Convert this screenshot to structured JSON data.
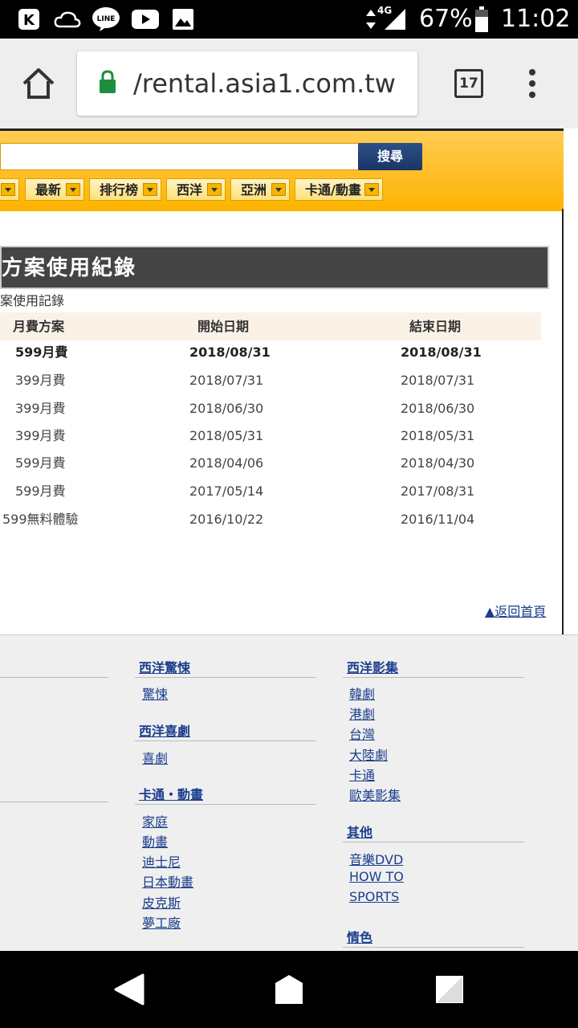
{
  "status_bar": {
    "battery_percent": "67%",
    "time": "11:02",
    "network": "4G",
    "icons": [
      "k-app-icon",
      "cloud-icon",
      "line-icon",
      "youtube-icon",
      "gallery-icon",
      "data-arrows-icon",
      "signal-icon",
      "battery-icon"
    ]
  },
  "browser": {
    "url": "/rental.asia1.com.tw",
    "tab_count": "17",
    "icons": [
      "home-icon",
      "lock-icon",
      "tabs-icon",
      "more-vert-icon"
    ]
  },
  "header": {
    "search_button": "搜尋",
    "search_value": "",
    "nav_tabs": [
      "最新",
      "排行榜",
      "西洋",
      "亞洲",
      "卡通/動畫"
    ]
  },
  "section": {
    "title": "方案使用紀錄",
    "caption": "案使用記錄"
  },
  "table": {
    "columns": [
      "月費方案",
      "開始日期",
      "結束日期"
    ],
    "rows": [
      {
        "plan": "599月費",
        "start": "2018/08/31",
        "end": "2018/08/31",
        "bold": true
      },
      {
        "plan": "399月費",
        "start": "2018/07/31",
        "end": "2018/07/31"
      },
      {
        "plan": "399月費",
        "start": "2018/06/30",
        "end": "2018/06/30"
      },
      {
        "plan": "399月費",
        "start": "2018/05/31",
        "end": "2018/05/31"
      },
      {
        "plan": "599月費",
        "start": "2018/04/06",
        "end": "2018/04/30"
      },
      {
        "plan": "599月費",
        "start": "2017/05/14",
        "end": "2017/08/31"
      },
      {
        "plan": "599無料體驗",
        "start": "2016/10/22",
        "end": "2016/11/04"
      }
    ]
  },
  "back_link": "▲返回首頁",
  "footer": {
    "col2": [
      {
        "title": "西洋驚悚",
        "links": [
          "驚悚"
        ]
      },
      {
        "title": "西洋喜劇",
        "links": [
          "喜劇"
        ]
      },
      {
        "title": "卡通・動畫",
        "links": [
          "家庭",
          "動畫",
          "迪士尼",
          "日本動畫",
          "皮克斯",
          "夢工廠"
        ]
      }
    ],
    "col3": [
      {
        "title": "西洋影集",
        "links": [
          "韓劇",
          "港劇",
          "台灣",
          "大陸劇",
          "卡通",
          "歐美影集"
        ]
      },
      {
        "title": "其他",
        "links": [
          "音樂DVD",
          "HOW TO",
          "SPORTS"
        ]
      },
      {
        "title": "情色",
        "links": []
      }
    ]
  },
  "colors": {
    "accent_orange": "#ffb300",
    "link_blue": "#1a3d8c",
    "section_dark": "#444444",
    "secure_green": "#1e8e3e"
  }
}
